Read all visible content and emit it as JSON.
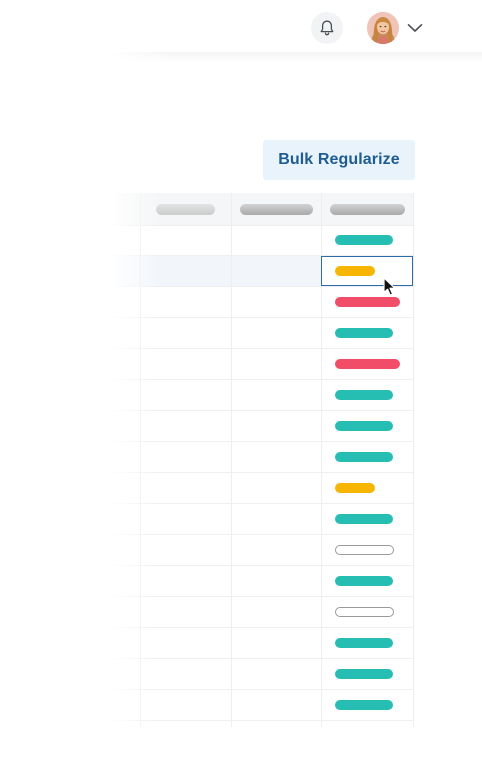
{
  "header": {
    "notifications": {
      "icon": "bell-icon"
    },
    "user_menu": {
      "avatar": "user-avatar",
      "dropdown_icon": "chevron-down-icon"
    }
  },
  "toolbar": {
    "bulk_regularize_label": "Bulk Regularize"
  },
  "attendance_grid": {
    "colors": {
      "present": "#26bdb3",
      "partial": "#f8b500",
      "absent": "#f14c68",
      "no_record": "#ffffff",
      "selection_border": "#2d6ca8",
      "header_background": "#f5f6f7"
    },
    "rows": [
      {
        "status": "present"
      },
      {
        "status": "partial",
        "selected": true
      },
      {
        "status": "absent"
      },
      {
        "status": "present"
      },
      {
        "status": "absent"
      },
      {
        "status": "present"
      },
      {
        "status": "present"
      },
      {
        "status": "present"
      },
      {
        "status": "partial"
      },
      {
        "status": "present"
      },
      {
        "status": "no_record"
      },
      {
        "status": "present"
      },
      {
        "status": "no_record"
      },
      {
        "status": "present"
      },
      {
        "status": "present"
      },
      {
        "status": "present"
      }
    ]
  }
}
